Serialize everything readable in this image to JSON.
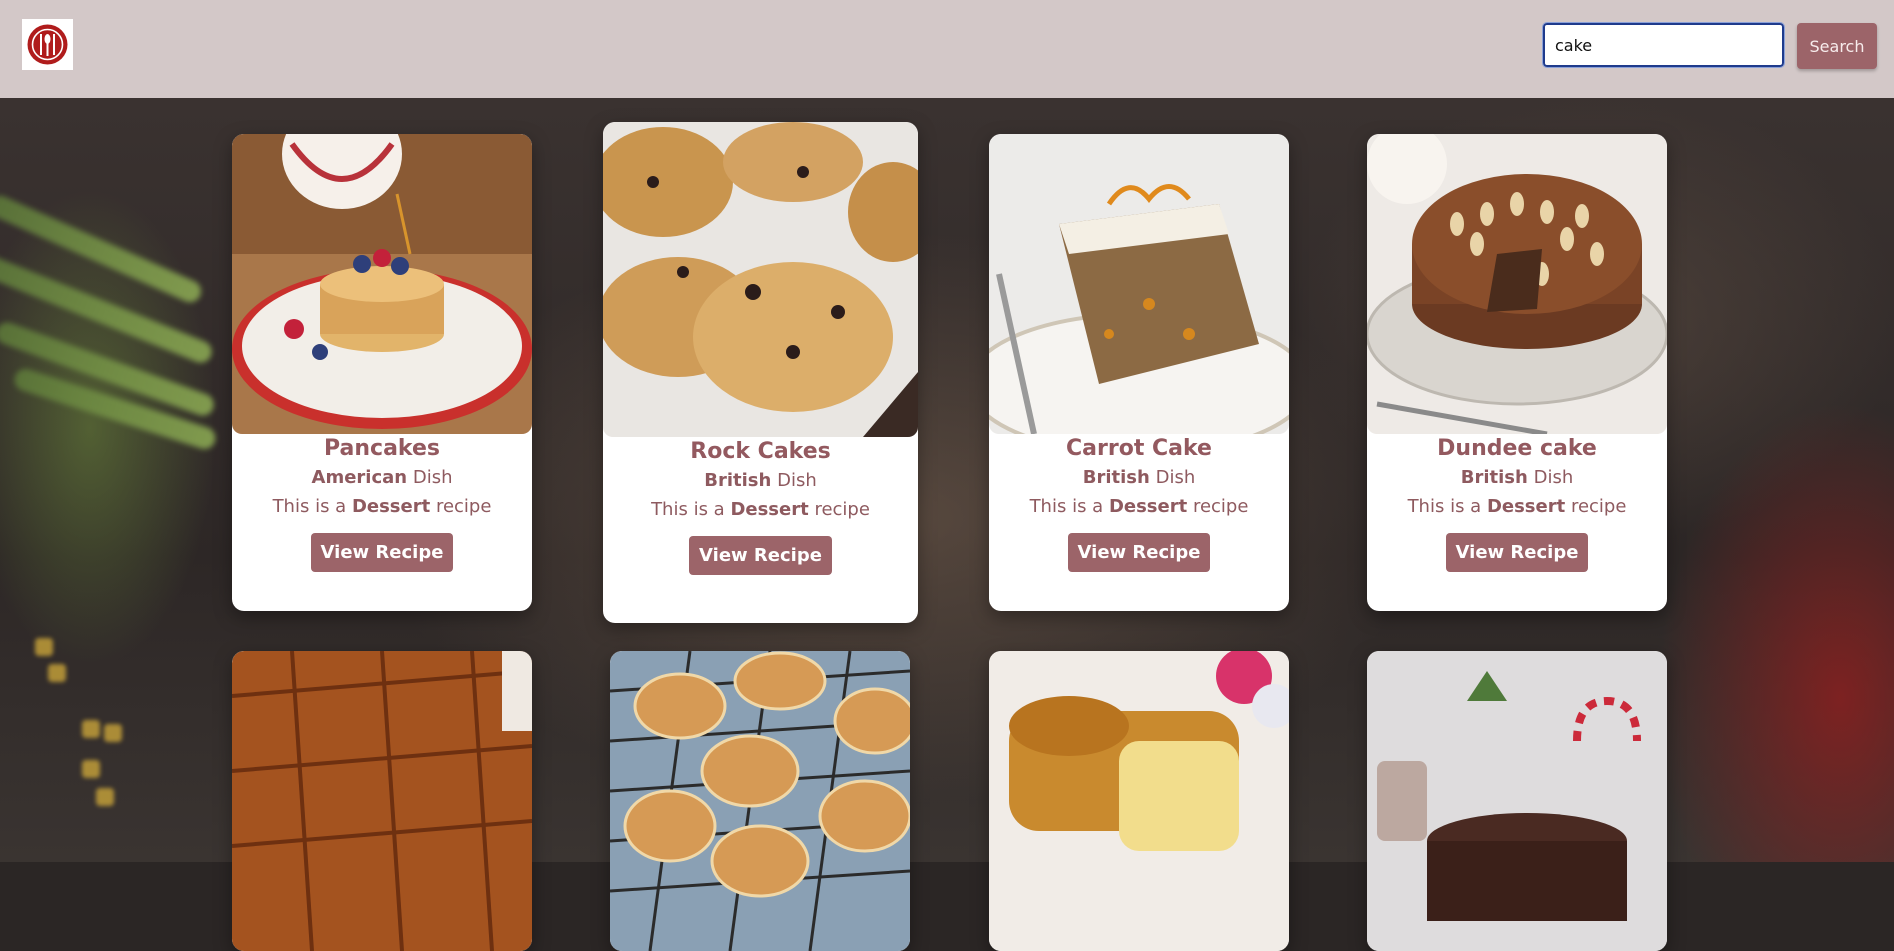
{
  "search": {
    "value": "cake",
    "button_label": "Search"
  },
  "cards": [
    {
      "title": "Pancakes",
      "cuisine": "American",
      "dish_word": "Dish",
      "desc_prefix": "This is a",
      "category": "Dessert",
      "desc_suffix": "recipe",
      "button": "View Recipe",
      "image": "pancakes-image"
    },
    {
      "title": "Rock Cakes",
      "cuisine": "British",
      "dish_word": "Dish",
      "desc_prefix": "This is a",
      "category": "Dessert",
      "desc_suffix": "recipe",
      "button": "View Recipe",
      "image": "rock-cakes-image"
    },
    {
      "title": "Carrot Cake",
      "cuisine": "British",
      "dish_word": "Dish",
      "desc_prefix": "This is a",
      "category": "Dessert",
      "desc_suffix": "recipe",
      "button": "View Recipe",
      "image": "carrot-cake-image"
    },
    {
      "title": "Dundee cake",
      "cuisine": "British",
      "dish_word": "Dish",
      "desc_prefix": "This is a",
      "category": "Dessert",
      "desc_suffix": "recipe",
      "button": "View Recipe",
      "image": "dundee-cake-image"
    },
    {
      "image": "parkin-image"
    },
    {
      "image": "scones-image"
    },
    {
      "image": "loaf-cake-image"
    },
    {
      "image": "christmas-cake-image"
    }
  ],
  "colors": {
    "accent": "#9c6469",
    "topbar": "#d3c8c8",
    "text": "#8e5a5f"
  }
}
